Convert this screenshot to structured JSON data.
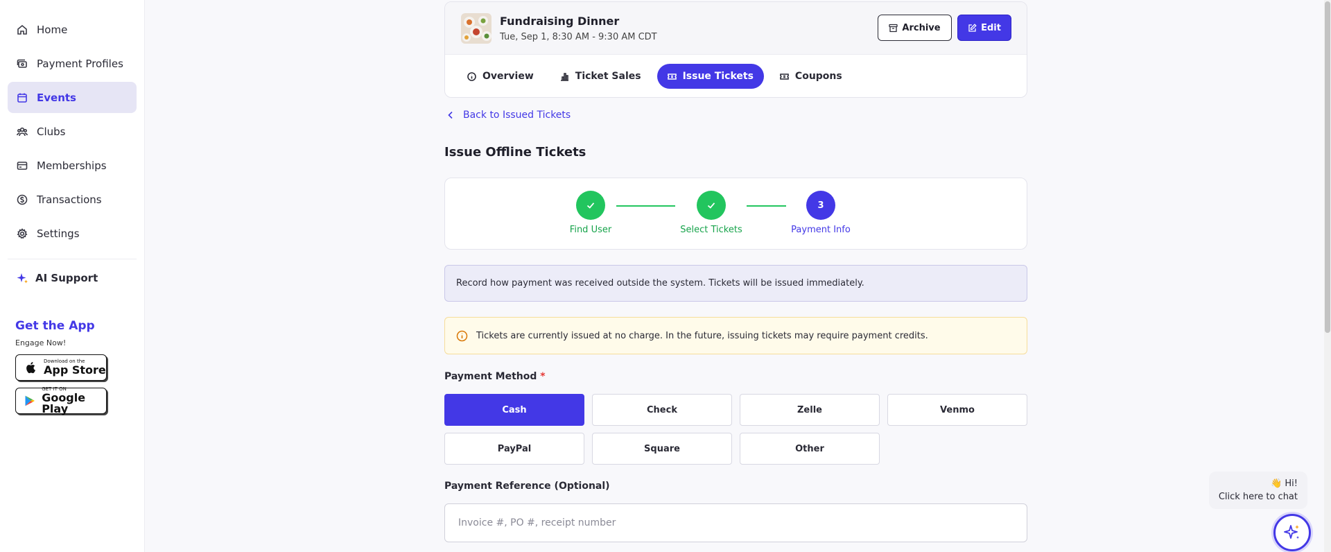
{
  "sidebar": {
    "items": [
      {
        "label": "Home",
        "icon": "home-icon",
        "active": false
      },
      {
        "label": "Payment Profiles",
        "icon": "payment-profiles-icon",
        "active": false
      },
      {
        "label": "Events",
        "icon": "calendar-icon",
        "active": true
      },
      {
        "label": "Clubs",
        "icon": "users-icon",
        "active": false
      },
      {
        "label": "Memberships",
        "icon": "card-icon",
        "active": false
      },
      {
        "label": "Transactions",
        "icon": "dollar-circle-icon",
        "active": false
      },
      {
        "label": "Settings",
        "icon": "gear-icon",
        "active": false
      }
    ],
    "ai_support": "AI Support",
    "get_app_title": "Get the App",
    "get_app_sub": "Engage Now!",
    "app_store_small": "Download on the",
    "app_store_big": "App Store",
    "google_play_small": "GET IT ON",
    "google_play_big": "Google Play"
  },
  "event": {
    "title": "Fundraising Dinner",
    "date": "Tue, Sep 1, 8:30 AM - 9:30 AM CDT",
    "archive_label": "Archive",
    "edit_label": "Edit"
  },
  "tabs": [
    {
      "label": "Overview",
      "icon": "info-icon",
      "active": false
    },
    {
      "label": "Ticket Sales",
      "icon": "bar-chart-icon",
      "active": false
    },
    {
      "label": "Issue Tickets",
      "icon": "ticket-icon",
      "active": true
    },
    {
      "label": "Coupons",
      "icon": "coupon-icon",
      "active": false
    }
  ],
  "back_link": "Back to Issued Tickets",
  "page_title": "Issue Offline Tickets",
  "steps": [
    {
      "label": "Find User",
      "status": "done"
    },
    {
      "label": "Select Tickets",
      "status": "done"
    },
    {
      "label": "Payment Info",
      "status": "current",
      "number": "3"
    }
  ],
  "info_text": "Record how payment was received outside the system. Tickets will be issued immediately.",
  "warning_text": "Tickets are currently issued at no charge. In the future, issuing tickets may require payment credits.",
  "payment_method": {
    "label": "Payment Method",
    "required_mark": "*",
    "options": [
      "Cash",
      "Check",
      "Zelle",
      "Venmo",
      "PayPal",
      "Square",
      "Other"
    ],
    "selected": "Cash"
  },
  "payment_reference": {
    "label": "Payment Reference (Optional)",
    "placeholder": "Invoice #, PO #, receipt number",
    "value": ""
  },
  "chat": {
    "line1": "👋 Hi!",
    "line2": "Click here to chat"
  },
  "colors": {
    "accent": "#4338e6",
    "success": "#22c55e",
    "warning_bg": "#fffbea",
    "info_bg": "#ececf8"
  }
}
